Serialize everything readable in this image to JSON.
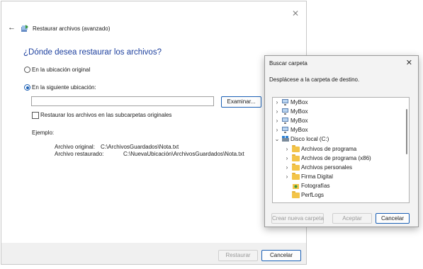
{
  "wizard": {
    "title": "Restaurar archivos (avanzado)",
    "heading": "¿Dónde desea restaurar los archivos?",
    "option_original": "En la ubicación original",
    "option_custom": "En la siguiente ubicación:",
    "path_value": "",
    "browse_button": "Examinar...",
    "subfolders_checkbox": "Restaurar los archivos en las subcarpetas originales",
    "example_label": "Ejemplo:",
    "original_label": "Archivo original:",
    "original_path": "C:\\ArchivosGuardados\\Nota.txt",
    "restored_label": "Archivo restaurado:",
    "restored_path": "C:\\NuevaUbicación\\ArchivosGuardados\\Nota.txt",
    "restore_button": "Restaurar",
    "cancel_button": "Cancelar"
  },
  "browse_dialog": {
    "title": "Buscar carpeta",
    "instruction": "Desplácese a la carpeta de destino.",
    "tree": [
      {
        "label": "MyBox",
        "icon": "network-computer-icon",
        "expanded": false
      },
      {
        "label": "MyBox",
        "icon": "network-computer-icon",
        "expanded": false
      },
      {
        "label": "MyBox",
        "icon": "network-computer-icon",
        "expanded": false
      },
      {
        "label": "MyBox",
        "icon": "network-computer-icon",
        "expanded": false
      },
      {
        "label": "Disco local (C:)",
        "icon": "drive-icon",
        "expanded": true
      },
      {
        "label": "Archivos de programa",
        "icon": "folder-icon",
        "expanded": false
      },
      {
        "label": "Archivos de programa (x86)",
        "icon": "folder-icon",
        "expanded": false
      },
      {
        "label": "Archivos personales",
        "icon": "folder-icon",
        "expanded": false
      },
      {
        "label": "Firma Digital",
        "icon": "folder-icon",
        "expanded": false
      },
      {
        "label": "Fotografías",
        "icon": "folder-icon",
        "expanded": null
      },
      {
        "label": "PerfLogs",
        "icon": "folder-icon",
        "expanded": null
      }
    ],
    "new_folder_button": "Crear nueva carpeta",
    "accept_button": "Aceptar",
    "cancel_button": "Cancelar"
  }
}
